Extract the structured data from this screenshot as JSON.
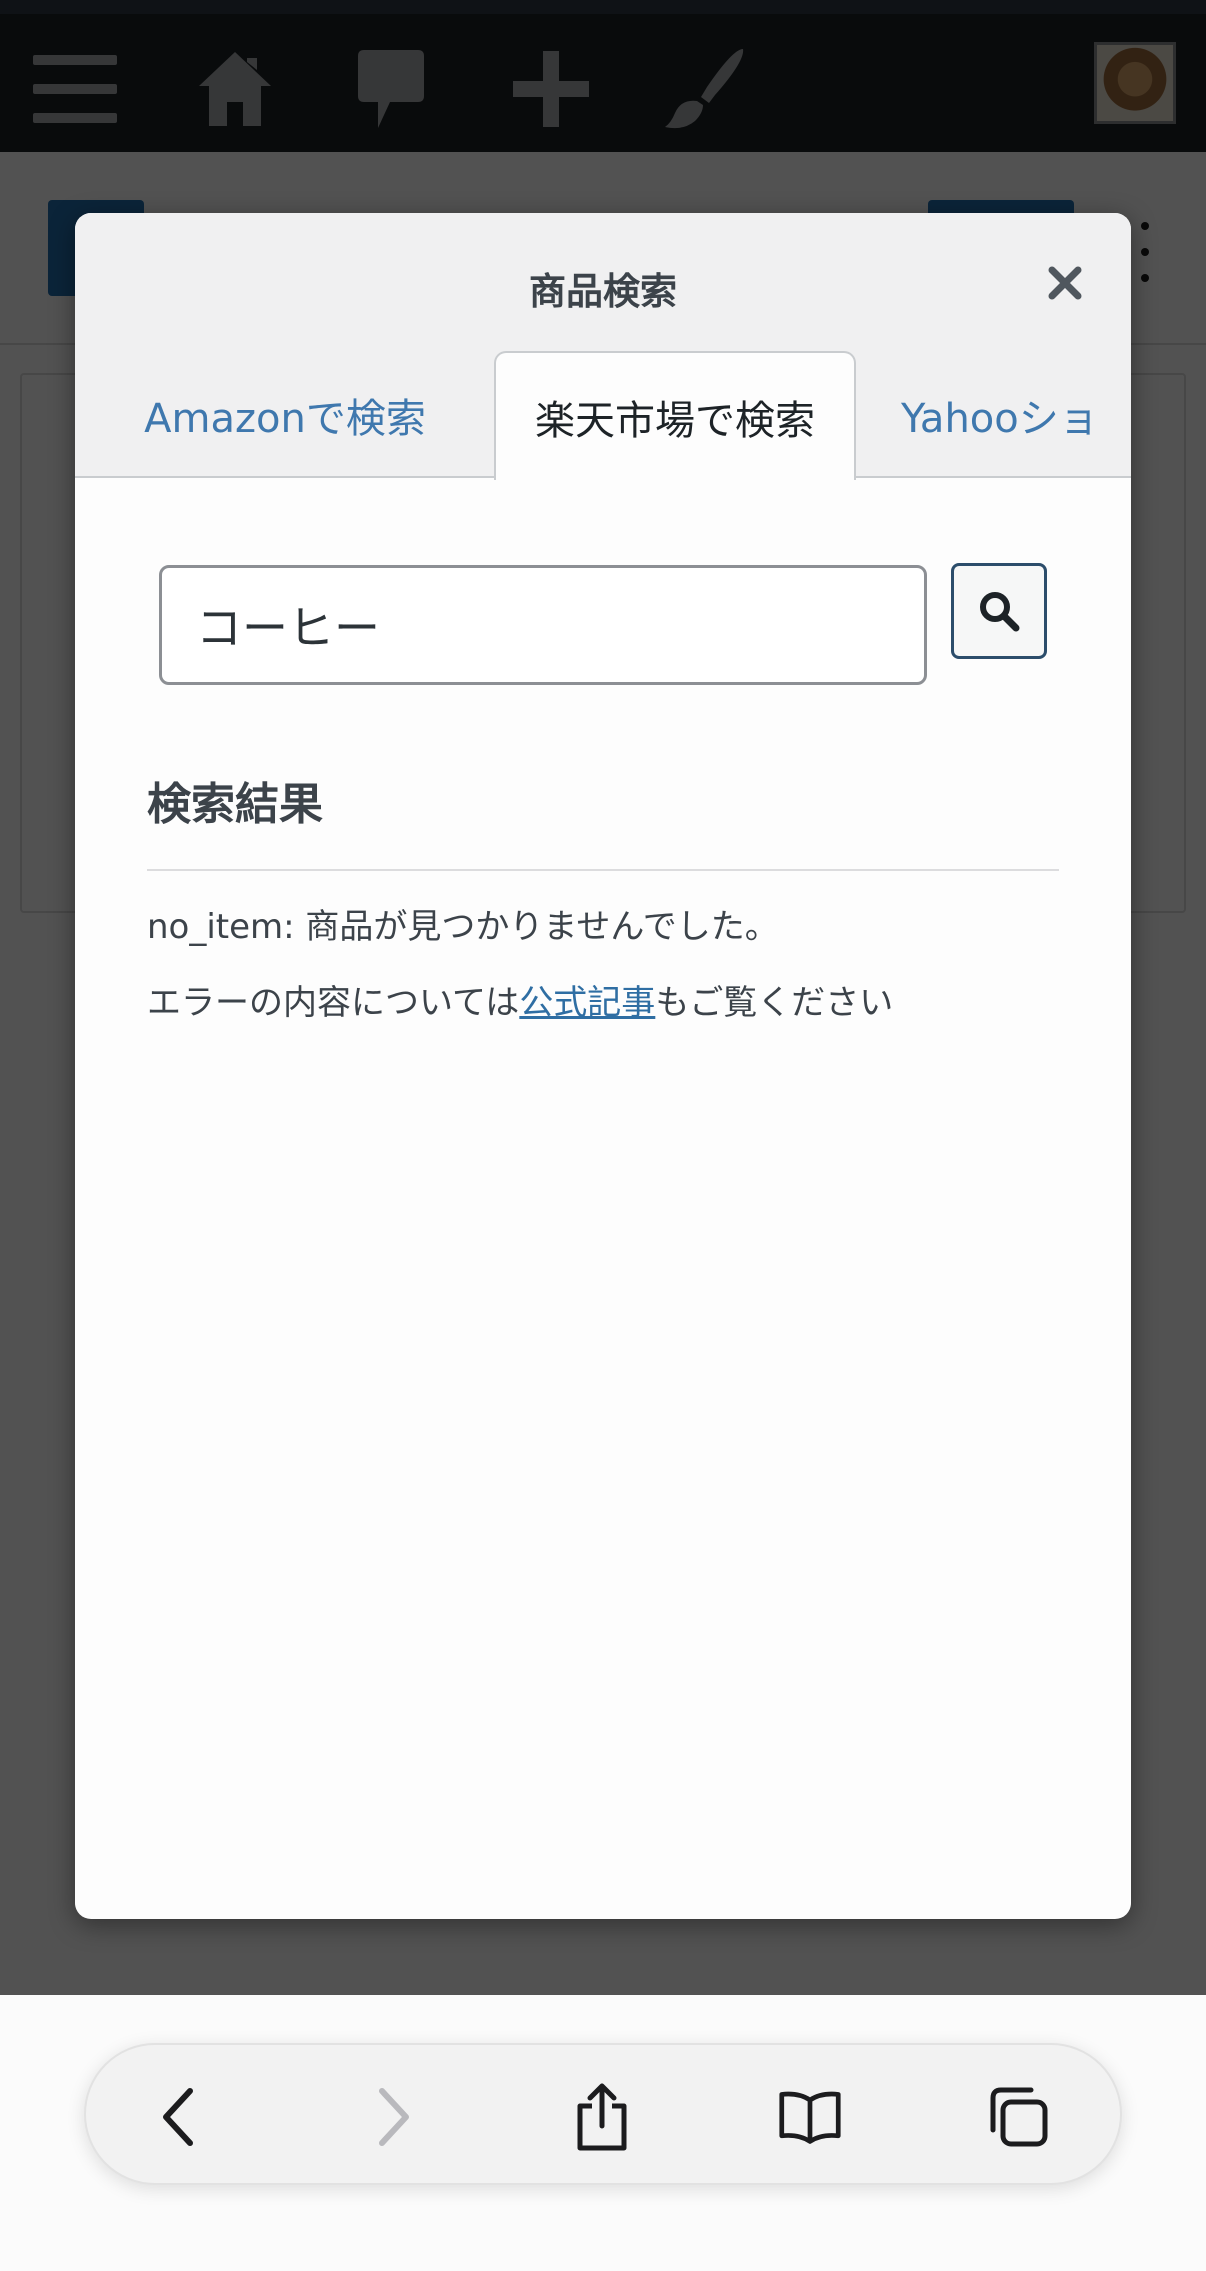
{
  "modal": {
    "title": "商品検索",
    "tabs": [
      {
        "label": "Amazonで検索",
        "active": false
      },
      {
        "label": "楽天市場で検索",
        "active": true
      },
      {
        "label": "Yahooショ",
        "active": false
      }
    ],
    "search": {
      "value": "コーヒー",
      "placeholder": ""
    },
    "results": {
      "heading": "検索結果",
      "message": "no_item: 商品が見つかりませんでした。",
      "note_prefix": "エラーの内容については",
      "note_link": "公式記事",
      "note_suffix": "もご覧ください"
    }
  },
  "colors": {
    "accent": "#2271b1",
    "link": "#2f6ea3",
    "tab_link": "#3f78ae",
    "admin_bar": "#1d2327"
  },
  "icons": {
    "admin_bar": [
      "menu-icon",
      "home-icon",
      "comment-icon",
      "plus-icon",
      "brush-icon"
    ],
    "modal": [
      "close-icon",
      "search-icon"
    ],
    "safari": [
      "back-icon",
      "forward-icon",
      "share-icon",
      "bookmarks-icon",
      "tabs-icon"
    ]
  }
}
